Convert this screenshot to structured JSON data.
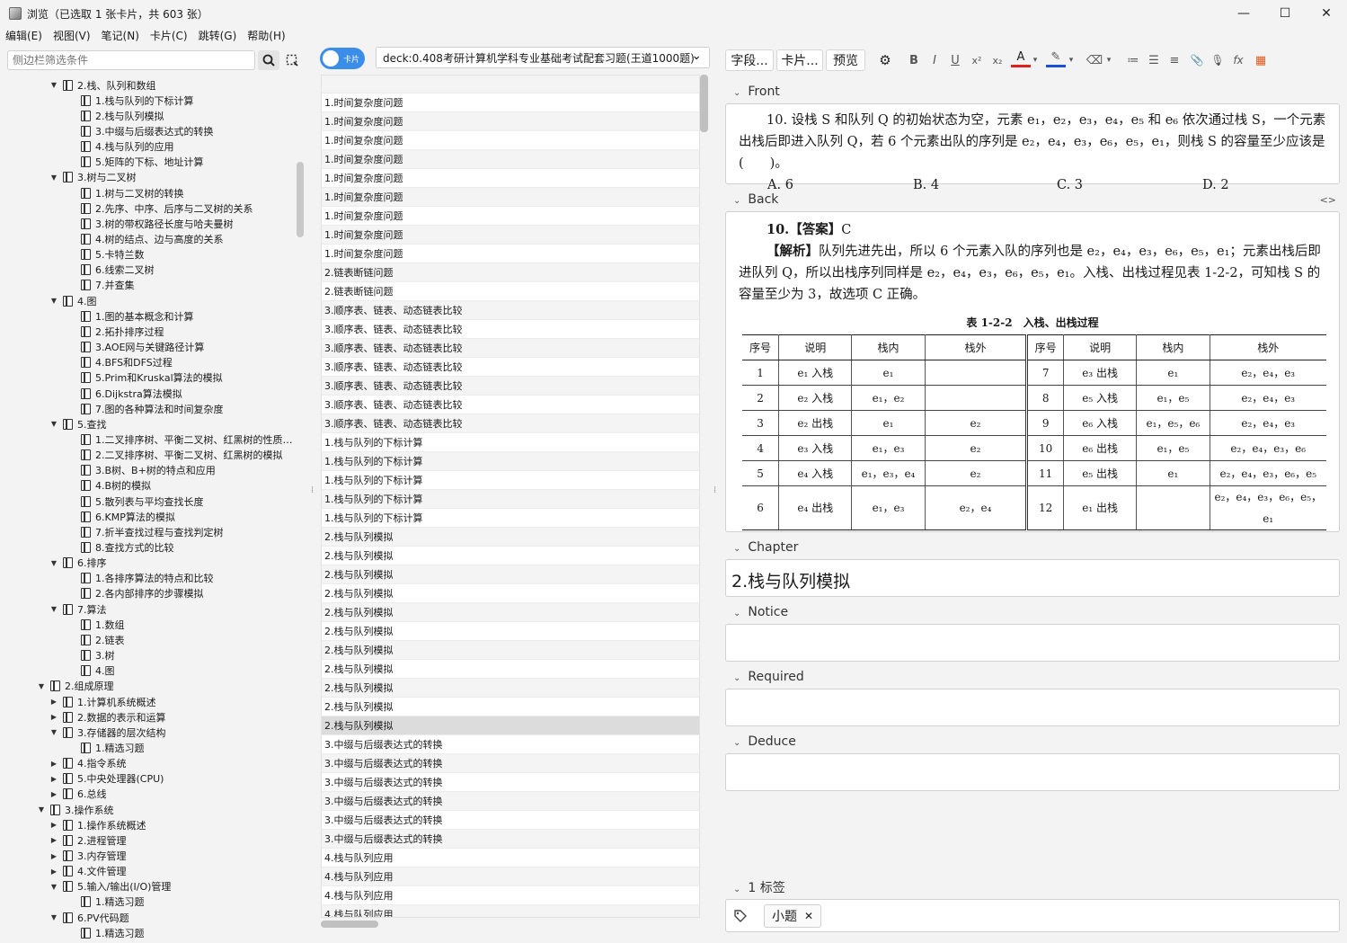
{
  "window": {
    "title": "浏览（已选取 1 张卡片，共 603 张）",
    "controls": [
      "—",
      "☐",
      "✕"
    ]
  },
  "menu": [
    "编辑(E)",
    "视图(V)",
    "笔记(N)",
    "卡片(C)",
    "跳转(G)",
    "帮助(H)"
  ],
  "sidebar": {
    "filter_placeholder": "侧边栏筛选条件",
    "tree": [
      {
        "l": "2.栈、队列和数组",
        "d": 2,
        "e": "open"
      },
      {
        "l": "1.栈与队列的下标计算",
        "d": 3,
        "e": ""
      },
      {
        "l": "2.栈与队列模拟",
        "d": 3,
        "e": ""
      },
      {
        "l": "3.中缀与后缀表达式的转换",
        "d": 3,
        "e": ""
      },
      {
        "l": "4.栈与队列的应用",
        "d": 3,
        "e": ""
      },
      {
        "l": "5.矩阵的下标、地址计算",
        "d": 3,
        "e": ""
      },
      {
        "l": "3.树与二叉树",
        "d": 2,
        "e": "open"
      },
      {
        "l": "1.树与二叉树的转换",
        "d": 3,
        "e": ""
      },
      {
        "l": "2.先序、中序、后序与二叉树的关系",
        "d": 3,
        "e": ""
      },
      {
        "l": "3.树的带权路径长度与哈夫曼树",
        "d": 3,
        "e": ""
      },
      {
        "l": "4.树的结点、边与高度的关系",
        "d": 3,
        "e": ""
      },
      {
        "l": "5.卡特兰数",
        "d": 3,
        "e": ""
      },
      {
        "l": "6.线索二叉树",
        "d": 3,
        "e": ""
      },
      {
        "l": "7.并查集",
        "d": 3,
        "e": ""
      },
      {
        "l": "4.图",
        "d": 2,
        "e": "open"
      },
      {
        "l": "1.图的基本概念和计算",
        "d": 3,
        "e": ""
      },
      {
        "l": "2.拓扑排序过程",
        "d": 3,
        "e": ""
      },
      {
        "l": "3.AOE网与关键路径计算",
        "d": 3,
        "e": ""
      },
      {
        "l": "4.BFS和DFS过程",
        "d": 3,
        "e": ""
      },
      {
        "l": "5.Prim和Kruskal算法的模拟",
        "d": 3,
        "e": ""
      },
      {
        "l": "6.Dijkstra算法模拟",
        "d": 3,
        "e": ""
      },
      {
        "l": "7.图的各种算法和时间复杂度",
        "d": 3,
        "e": ""
      },
      {
        "l": "5.查找",
        "d": 2,
        "e": "open"
      },
      {
        "l": "1.二叉排序树、平衡二叉树、红黑树的性质…",
        "d": 3,
        "e": ""
      },
      {
        "l": "2.二叉排序树、平衡二叉树、红黑树的模拟",
        "d": 3,
        "e": ""
      },
      {
        "l": "3.B树、B+树的特点和应用",
        "d": 3,
        "e": ""
      },
      {
        "l": "4.B树的模拟",
        "d": 3,
        "e": ""
      },
      {
        "l": "5.散列表与平均查找长度",
        "d": 3,
        "e": ""
      },
      {
        "l": "6.KMP算法的模拟",
        "d": 3,
        "e": ""
      },
      {
        "l": "7.折半查找过程与查找判定树",
        "d": 3,
        "e": ""
      },
      {
        "l": "8.查找方式的比较",
        "d": 3,
        "e": ""
      },
      {
        "l": "6.排序",
        "d": 2,
        "e": "open"
      },
      {
        "l": "1.各排序算法的特点和比较",
        "d": 3,
        "e": ""
      },
      {
        "l": "2.各内部排序的步骤模拟",
        "d": 3,
        "e": ""
      },
      {
        "l": "7.算法",
        "d": 2,
        "e": "open"
      },
      {
        "l": "1.数组",
        "d": 3,
        "e": ""
      },
      {
        "l": "2.链表",
        "d": 3,
        "e": ""
      },
      {
        "l": "3.树",
        "d": 3,
        "e": ""
      },
      {
        "l": "4.图",
        "d": 3,
        "e": ""
      },
      {
        "l": "2.组成原理",
        "d": 1,
        "e": "open"
      },
      {
        "l": "1.计算机系统概述",
        "d": 2,
        "e": "closed"
      },
      {
        "l": "2.数据的表示和运算",
        "d": 2,
        "e": "closed"
      },
      {
        "l": "3.存储器的层次结构",
        "d": 2,
        "e": "open"
      },
      {
        "l": "1.精选习题",
        "d": 3,
        "e": ""
      },
      {
        "l": "4.指令系统",
        "d": 2,
        "e": "closed"
      },
      {
        "l": "5.中央处理器(CPU)",
        "d": 2,
        "e": "closed"
      },
      {
        "l": "6.总线",
        "d": 2,
        "e": "closed"
      },
      {
        "l": "3.操作系统",
        "d": 1,
        "e": "open"
      },
      {
        "l": "1.操作系统概述",
        "d": 2,
        "e": "closed"
      },
      {
        "l": "2.进程管理",
        "d": 2,
        "e": "closed"
      },
      {
        "l": "3.内存管理",
        "d": 2,
        "e": "closed"
      },
      {
        "l": "4.文件管理",
        "d": 2,
        "e": "closed"
      },
      {
        "l": "5.输入/输出(I/O)管理",
        "d": 2,
        "e": "open"
      },
      {
        "l": "1.精选习题",
        "d": 3,
        "e": ""
      },
      {
        "l": "6.PV代码题",
        "d": 2,
        "e": "open"
      },
      {
        "l": "1.精选习题",
        "d": 3,
        "e": ""
      }
    ]
  },
  "browser": {
    "toggle_label": "卡片",
    "deck": "deck:0.408考研计算机学科专业基础考试配套习题(王道1000题)",
    "rows": [
      "",
      "1.时间复杂度问题",
      "1.时间复杂度问题",
      "1.时间复杂度问题",
      "1.时间复杂度问题",
      "1.时间复杂度问题",
      "1.时间复杂度问题",
      "1.时间复杂度问题",
      "1.时间复杂度问题",
      "1.时间复杂度问题",
      "2.链表断链问题",
      "2.链表断链问题",
      "3.顺序表、链表、动态链表比较",
      "3.顺序表、链表、动态链表比较",
      "3.顺序表、链表、动态链表比较",
      "3.顺序表、链表、动态链表比较",
      "3.顺序表、链表、动态链表比较",
      "3.顺序表、链表、动态链表比较",
      "3.顺序表、链表、动态链表比较",
      "1.栈与队列的下标计算",
      "1.栈与队列的下标计算",
      "1.栈与队列的下标计算",
      "1.栈与队列的下标计算",
      "1.栈与队列的下标计算",
      "2.栈与队列模拟",
      "2.栈与队列模拟",
      "2.栈与队列模拟",
      "2.栈与队列模拟",
      "2.栈与队列模拟",
      "2.栈与队列模拟",
      "2.栈与队列模拟",
      "2.栈与队列模拟",
      "2.栈与队列模拟",
      "2.栈与队列模拟",
      "2.栈与队列模拟",
      "3.中缀与后缀表达式的转换",
      "3.中缀与后缀表达式的转换",
      "3.中缀与后缀表达式的转换",
      "3.中缀与后缀表达式的转换",
      "3.中缀与后缀表达式的转换",
      "3.中缀与后缀表达式的转换",
      "4.栈与队列应用",
      "4.栈与队列应用",
      "4.栈与队列应用",
      "4.栈与队列应用"
    ],
    "selected_row": 34
  },
  "editor": {
    "btn_fields": "字段...",
    "btn_cards": "卡片...",
    "btn_preview": "预览",
    "toolbar_icons": [
      "⚙",
      "B",
      "I",
      "U",
      "x²",
      "x₂",
      "A",
      "▾",
      "✎",
      "▾",
      "⌫",
      "▾",
      "≔",
      "☰",
      "≡",
      "📎",
      "🎙",
      "fx",
      "▦"
    ],
    "fields": {
      "front": "Front",
      "back": "Back",
      "chapter": "Chapter",
      "notice": "Notice",
      "required": "Required",
      "deduce": "Deduce"
    },
    "front": {
      "q": "10. 设栈 S 和队列 Q 的初始状态为空，元素 e₁，e₂，e₃，e₄，e₅ 和 e₆ 依次通过栈 S，一个元素出栈后即进入队列 Q，若 6 个元素出队的序列是 e₂，e₄，e₃，e₆，e₅，e₁，则栈 S 的容量至少应该是(　　)。",
      "options": [
        "A. 6",
        "B. 4",
        "C. 3",
        "D. 2"
      ]
    },
    "back": {
      "answer_head": "10.【答案】",
      "answer": "C",
      "analysis_head": "【解析】",
      "analysis": "队列先进先出，所以 6 个元素入队的序列也是 e₂，e₄，e₃，e₆，e₅，e₁；元素出栈后即进队列 Q，所以出栈序列同样是 e₂，e₄，e₃，e₆，e₅，e₁。入栈、出栈过程见表 1-2-2，可知栈 S 的容量至少为 3，故选项 C 正确。",
      "table_title": "表 1-2-2　入栈、出栈过程",
      "headers": [
        "序号",
        "说明",
        "栈内",
        "栈外",
        "序号",
        "说明",
        "栈内",
        "栈外"
      ],
      "rows": [
        [
          "1",
          "e₁ 入栈",
          "e₁",
          "",
          "7",
          "e₃ 出栈",
          "e₁",
          "e₂，e₄，e₃"
        ],
        [
          "2",
          "e₂ 入栈",
          "e₁，e₂",
          "",
          "8",
          "e₅ 入栈",
          "e₁，e₅",
          "e₂，e₄，e₃"
        ],
        [
          "3",
          "e₂ 出栈",
          "e₁",
          "e₂",
          "9",
          "e₆ 入栈",
          "e₁，e₅，e₆",
          "e₂，e₄，e₃"
        ],
        [
          "4",
          "e₃ 入栈",
          "e₁，e₃",
          "e₂",
          "10",
          "e₆ 出栈",
          "e₁，e₅",
          "e₂，e₄，e₃，e₆"
        ],
        [
          "5",
          "e₄ 入栈",
          "e₁，e₃，e₄",
          "e₂",
          "11",
          "e₅ 出栈",
          "e₁",
          "e₂，e₄，e₃，e₆，e₅"
        ],
        [
          "6",
          "e₄ 出栈",
          "e₁，e₃",
          "e₂，e₄",
          "12",
          "e₁ 出栈",
          "",
          "e₂，e₄，e₃，e₆，e₅，e₁"
        ]
      ]
    },
    "chapter_value": "2.栈与队列模拟",
    "tags_label": "1 标签",
    "tag": "小题"
  }
}
